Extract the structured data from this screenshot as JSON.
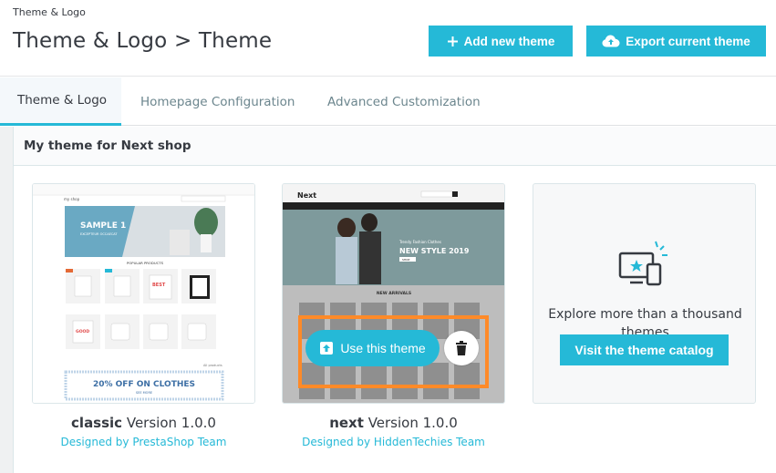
{
  "header": {
    "breadcrumb": "Theme & Logo",
    "title": "Theme & Logo > Theme",
    "add_button_label": "Add new theme",
    "export_button_label": "Export current theme"
  },
  "tabs": [
    {
      "label": "Theme & Logo",
      "active": true
    },
    {
      "label": "Homepage Configuration",
      "active": false
    },
    {
      "label": "Advanced Customization",
      "active": false
    }
  ],
  "section": {
    "title": "My theme for Next shop"
  },
  "themes": [
    {
      "name": "classic",
      "version": "Version 1.0.0",
      "author": "Designed by PrestaShop Team",
      "preview": {
        "logo": "my shop",
        "banner_title": "SAMPLE 1",
        "banner_sub": "EXCEPTEUR OCCAECAT",
        "section": "POPULAR PRODUCTS",
        "promo": "20% OFF ON CLOTHES",
        "promo_sub": "SEE MORE",
        "all_products": "All products"
      }
    },
    {
      "name": "next",
      "version": "Version 1.0.0",
      "author": "Designed by HiddenTechies Team",
      "preview": {
        "logo": "Next",
        "hero_kicker": "Trendy Fashion Clothes",
        "hero_title": "NEW STYLE 2019",
        "hero_button": "SHOP",
        "section": "NEW ARRIVALS"
      }
    }
  ],
  "catalog": {
    "text": "Explore more than a thousand themes",
    "button_label": "Visit the theme catalog"
  },
  "actions": {
    "use_theme_label": "Use this theme"
  },
  "colors": {
    "accent": "#25b9d7",
    "highlight": "#ff8a28",
    "text": "#363a41"
  },
  "icons": {
    "add": "plus-icon",
    "export": "cloud-upload-icon",
    "catalog": "devices-star-icon",
    "use": "upload-icon",
    "delete": "trash-icon"
  }
}
